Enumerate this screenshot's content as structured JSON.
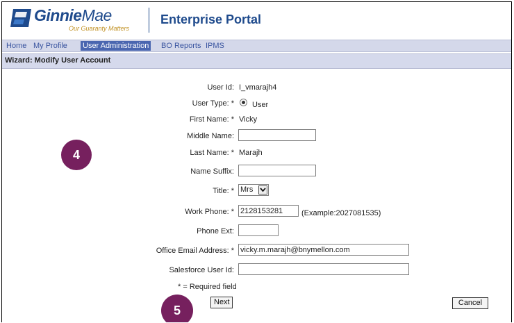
{
  "header": {
    "logo_name": "Ginnie",
    "logo_name_light": "Mae",
    "logo_tagline": "Our Guaranty Matters",
    "portal_title": "Enterprise Portal"
  },
  "nav": {
    "items": [
      {
        "label": "Home"
      },
      {
        "label": "My Profile"
      },
      {
        "label": "User Administration",
        "active": true
      },
      {
        "label": "BO Reports"
      },
      {
        "label": "IPMS"
      }
    ]
  },
  "wizard": {
    "title": "Wizard: Modify User Account"
  },
  "form": {
    "user_id_label": "User Id:",
    "user_id_value": "I_vmarajh4",
    "user_type_label": "User Type: *",
    "user_type_value": "User",
    "first_name_label": "First Name: *",
    "first_name_value": "Vicky",
    "middle_name_label": "Middle Name:",
    "middle_name_value": "",
    "last_name_label": "Last Name: *",
    "last_name_value": "Marajh",
    "name_suffix_label": "Name Suffix:",
    "name_suffix_value": "",
    "title_label": "Title: *",
    "title_value": "Mrs",
    "work_phone_label": "Work Phone: *",
    "work_phone_value": "2128153281",
    "work_phone_example": "(Example:2027081535)",
    "phone_ext_label": "Phone Ext:",
    "phone_ext_value": "",
    "email_label": "Office Email Address: *",
    "email_value": "vicky.m.marajh@bnymellon.com",
    "salesforce_label": "Salesforce User Id:",
    "salesforce_value": "",
    "required_note": "* = Required field",
    "next_label": "Next",
    "cancel_label": "Cancel"
  },
  "callouts": {
    "step_4": "4",
    "step_5": "5",
    "color": "#76205e"
  }
}
